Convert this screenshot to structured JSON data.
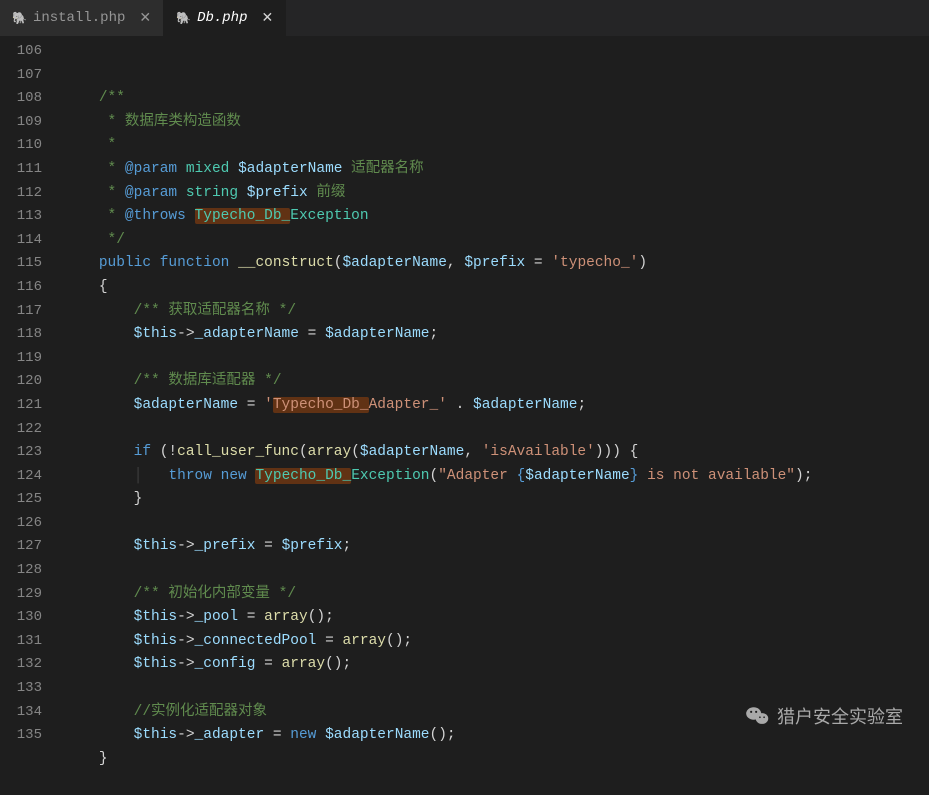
{
  "tabs": [
    {
      "label": "install.php",
      "active": false
    },
    {
      "label": "Db.php",
      "active": true
    }
  ],
  "lineStart": 106,
  "lineEnd": 135,
  "code": {
    "l106": "",
    "l107_comment": "/**",
    "l108_comment": " * 数据库类构造函数",
    "l109_comment": " *",
    "l110_pre": " * ",
    "l110_tag": "@param",
    "l110_type": "mixed",
    "l110_var": "$adapterName",
    "l110_cn": " 适配器名称",
    "l111_pre": " * ",
    "l111_tag": "@param",
    "l111_type": "string",
    "l111_var": "$prefix",
    "l111_cn": " 前缀",
    "l112_pre": " * ",
    "l112_tag": "@throws",
    "l112_hl": "Typecho_Db_",
    "l112_cls": "Exception",
    "l113_comment": " */",
    "l114_kw1": "public",
    "l114_kw2": "function",
    "l114_fn": "__construct",
    "l114_v1": "$adapterName",
    "l114_v2": "$prefix",
    "l114_str": "'typecho_'",
    "l115_brace": "{",
    "l116_comment": "/** 获取适配器名称 */",
    "l117_this": "$this",
    "l117_prop": "_adapterName",
    "l117_var": "$adapterName",
    "l118": "",
    "l119_comment": "/** 数据库适配器 */",
    "l120_var": "$adapterName",
    "l120_str1": "'",
    "l120_hl": "Typecho_Db_",
    "l120_str2": "Adapter_'",
    "l120_var2": "$adapterName",
    "l121": "",
    "l122_kw": "if",
    "l122_fn": "call_user_func",
    "l122_fn2": "array",
    "l122_var": "$adapterName",
    "l122_str": "'isAvailable'",
    "l123_kw1": "throw",
    "l123_kw2": "new",
    "l123_hl": "Typecho_Db_",
    "l123_cls": "Exception",
    "l123_str1": "\"Adapter ",
    "l123_str2": "{",
    "l123_var": "$adapterName",
    "l123_str3": "}",
    "l123_str4": " is not available\"",
    "l124_brace": "}",
    "l125": "",
    "l126_this": "$this",
    "l126_prop": "_prefix",
    "l126_var": "$prefix",
    "l127": "",
    "l128_comment": "/** 初始化内部变量 */",
    "l129_this": "$this",
    "l129_prop": "_pool",
    "l129_fn": "array",
    "l130_this": "$this",
    "l130_prop": "_connectedPool",
    "l130_fn": "array",
    "l131_this": "$this",
    "l131_prop": "_config",
    "l131_fn": "array",
    "l132": "",
    "l133_comment": "//实例化适配器对象",
    "l134_this": "$this",
    "l134_prop": "_adapter",
    "l134_kw": "new",
    "l134_var": "$adapterName",
    "l135_brace": "}"
  },
  "watermark": "猎户安全实验室"
}
